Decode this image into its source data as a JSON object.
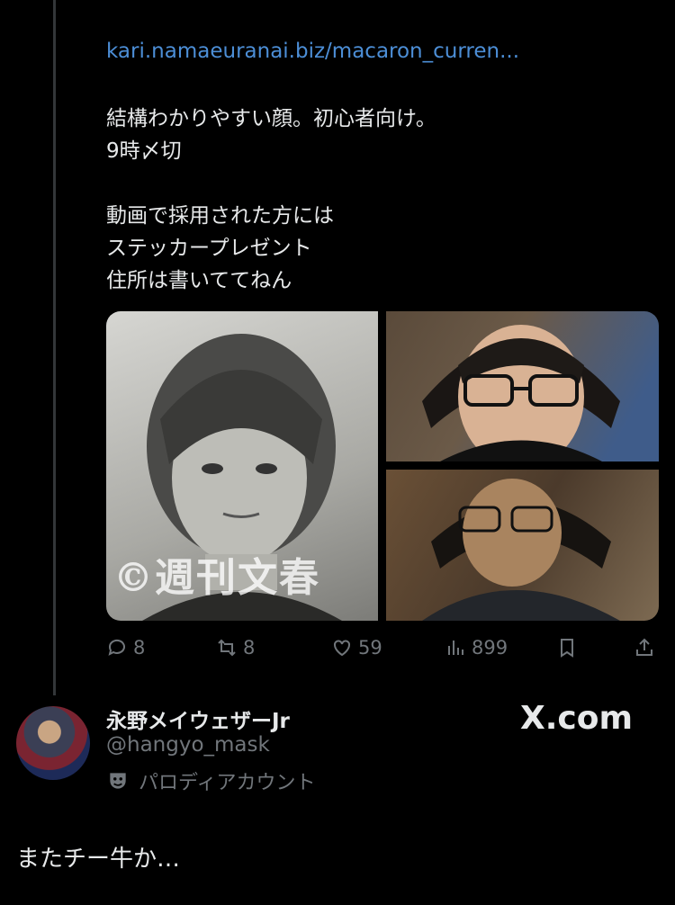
{
  "tweet": {
    "link": "kari.namaeuranai.biz/macaron_curren...",
    "lines": [
      "結構わかりやすい顔。初心者向け。",
      "9時〆切",
      "",
      "動画で採用された方には",
      "ステッカープレゼント",
      "住所は書いててねん"
    ],
    "media": {
      "watermark": "©週刊文春"
    },
    "actions": {
      "replies": "8",
      "reposts": "8",
      "likes": "59",
      "views": "899"
    }
  },
  "author": {
    "name": "永野メイウェザーJr",
    "handle": "@hangyo_mask",
    "parody_label": "パロディアカウント"
  },
  "brand": "X.com",
  "reply_text": "またチー牛か…",
  "colors": {
    "background": "#000000",
    "link": "#4c8ed6",
    "muted": "#71767b",
    "text": "#e7e9ea"
  }
}
